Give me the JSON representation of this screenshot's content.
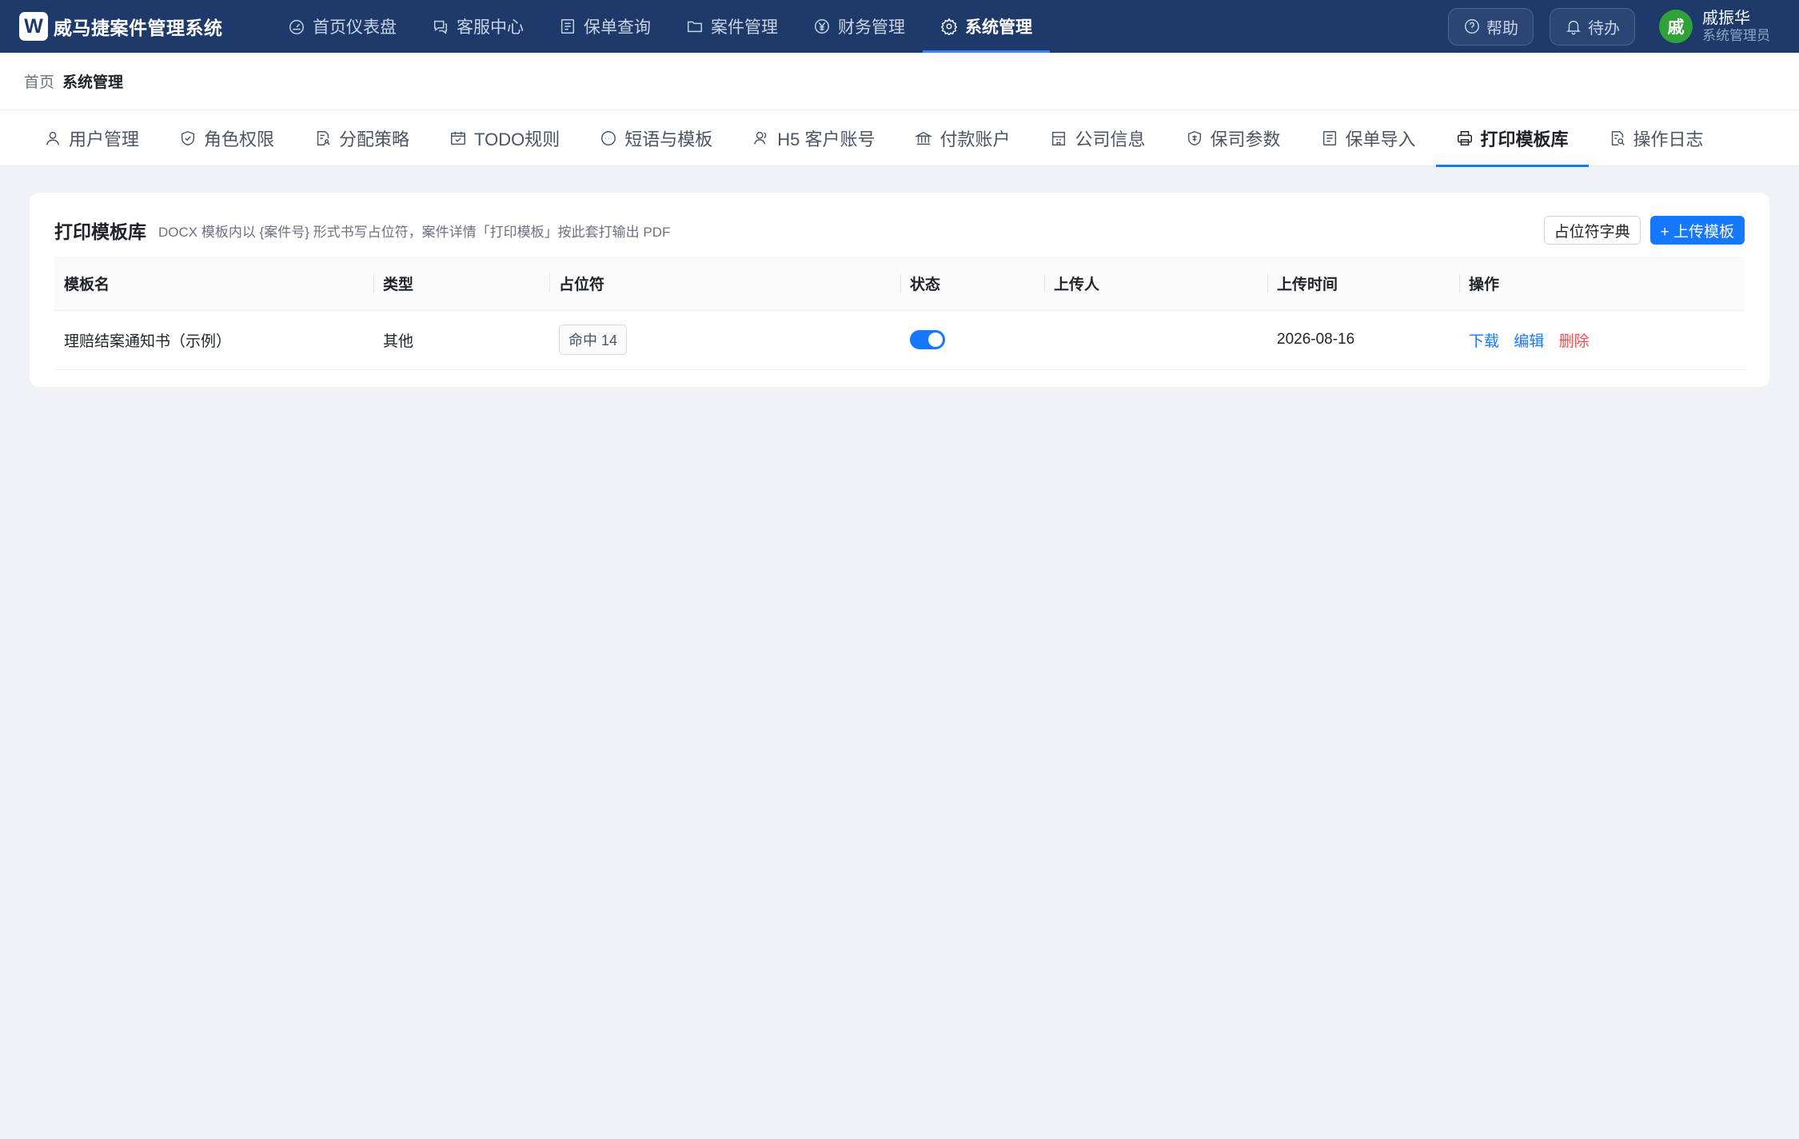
{
  "app": {
    "logo_letter": "W",
    "name": "威马捷案件管理系统"
  },
  "nav": {
    "items": [
      {
        "label": "首页仪表盘",
        "icon": "dashboard-icon"
      },
      {
        "label": "客服中心",
        "icon": "chat-icon"
      },
      {
        "label": "保单查询",
        "icon": "document-list-icon"
      },
      {
        "label": "案件管理",
        "icon": "folder-icon"
      },
      {
        "label": "财务管理",
        "icon": "yen-circle-icon"
      },
      {
        "label": "系统管理",
        "icon": "gear-icon",
        "active": true
      }
    ]
  },
  "topbar": {
    "help_label": "帮助",
    "todo_label": "待办",
    "user": {
      "avatar_char": "戚",
      "name": "戚振华",
      "role": "系统管理员"
    }
  },
  "breadcrumb": {
    "home": "首页",
    "current": "系统管理"
  },
  "subtabs": [
    {
      "label": "用户管理",
      "icon": "user-icon"
    },
    {
      "label": "角色权限",
      "icon": "shield-check-icon"
    },
    {
      "label": "分配策略",
      "icon": "doc-person-icon"
    },
    {
      "label": "TODO规则",
      "icon": "calendar-check-icon"
    },
    {
      "label": "短语与模板",
      "icon": "chat-dots-icon"
    },
    {
      "label": "H5 客户账号",
      "icon": "users-icon"
    },
    {
      "label": "付款账户",
      "icon": "bank-icon"
    },
    {
      "label": "公司信息",
      "icon": "building-icon"
    },
    {
      "label": "保司参数",
      "icon": "insurance-badge-icon"
    },
    {
      "label": "保单导入",
      "icon": "import-list-icon"
    },
    {
      "label": "打印模板库",
      "icon": "printer-icon",
      "active": true
    },
    {
      "label": "操作日志",
      "icon": "log-search-icon"
    }
  ],
  "card": {
    "title": "打印模板库",
    "description": "DOCX 模板内以 {案件号} 形式书写占位符，案件详情「打印模板」按此套打输出 PDF",
    "dict_button": "占位符字典",
    "upload_button": "+ 上传模板"
  },
  "table": {
    "columns": [
      "模板名",
      "类型",
      "占位符",
      "状态",
      "上传人",
      "上传时间",
      "操作"
    ],
    "rows": [
      {
        "name": "理赔结案通知书（示例）",
        "type": "其他",
        "placeholder_tag": "命中 14",
        "status_enabled": true,
        "uploader": "",
        "upload_time": "2026-08-16",
        "actions": {
          "download": "下载",
          "edit": "编辑",
          "delete": "删除"
        }
      }
    ]
  },
  "colors": {
    "topbar": "#1d3a6b",
    "primary": "#1677ff",
    "danger": "#ff4d4f",
    "avatar": "#31a23a"
  }
}
